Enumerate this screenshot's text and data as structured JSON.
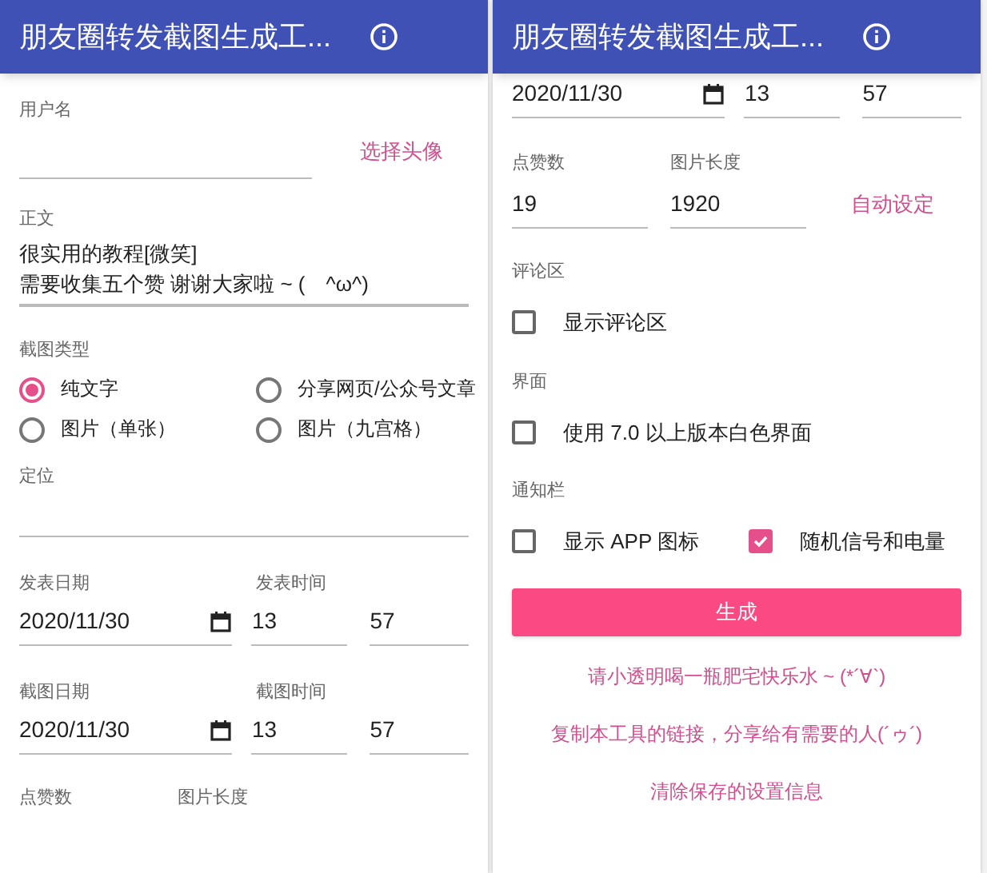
{
  "screens": [
    {
      "title": "朋友圈转发截图生成工...",
      "sections": [
        {
          "kind": "username",
          "label": "用户名",
          "link": "选择头像"
        },
        {
          "kind": "textarea",
          "label": "正文",
          "lines": [
            "很实用的教程[微笑]",
            "需要收集五个赞 谢谢大家啦 ~ (　^ω^)"
          ]
        },
        {
          "kind": "radios",
          "label": "截图类型",
          "options": [
            {
              "label": "纯文字",
              "selected": true
            },
            {
              "label": "分享网页/公众号文章",
              "selected": false
            },
            {
              "label": "图片（单张）",
              "selected": false
            },
            {
              "label": "图片（九宫格）",
              "selected": false
            }
          ]
        },
        {
          "kind": "field",
          "label": "定位"
        },
        {
          "kind": "datetime",
          "label": "发表日期",
          "time_label": "发表时间",
          "date": "2020/11/30",
          "hour": "13",
          "minute": "57"
        },
        {
          "kind": "datetime",
          "label": "截图日期",
          "time_label": "截图时间",
          "date": "2020/11/30",
          "hour": "13",
          "minute": "57"
        },
        {
          "kind": "labels",
          "labels": [
            "点赞数",
            "图片长度"
          ]
        }
      ]
    },
    {
      "title": "朋友圈转发截图生成工...",
      "sections": [
        {
          "kind": "datetime",
          "date": "2020/11/30",
          "hour": "13",
          "minute": "57"
        },
        {
          "kind": "numbers",
          "likes_label": "点赞数",
          "likes": "19",
          "length_label": "图片长度",
          "length": "1920",
          "link": "自动设定"
        },
        {
          "kind": "checks",
          "label": "评论区",
          "options": [
            {
              "label": "显示评论区",
              "checked": false
            }
          ]
        },
        {
          "kind": "checks",
          "label": "界面",
          "options": [
            {
              "label": "使用 7.0 以上版本白色界面",
              "checked": false
            }
          ]
        },
        {
          "kind": "checks",
          "label": "通知栏",
          "options": [
            {
              "label": "显示 APP 图标",
              "checked": false
            },
            {
              "label": "随机信号和电量",
              "checked": true
            }
          ]
        },
        {
          "kind": "button",
          "label": "生成"
        },
        {
          "kind": "link",
          "text": "请小透明喝一瓶肥宅快乐水 ~ (*´∀`)"
        },
        {
          "kind": "link",
          "text": "复制本工具的链接，分享给有需要的人(´ゥ´)"
        },
        {
          "kind": "link",
          "text": "清除保存的设置信息"
        }
      ]
    }
  ]
}
